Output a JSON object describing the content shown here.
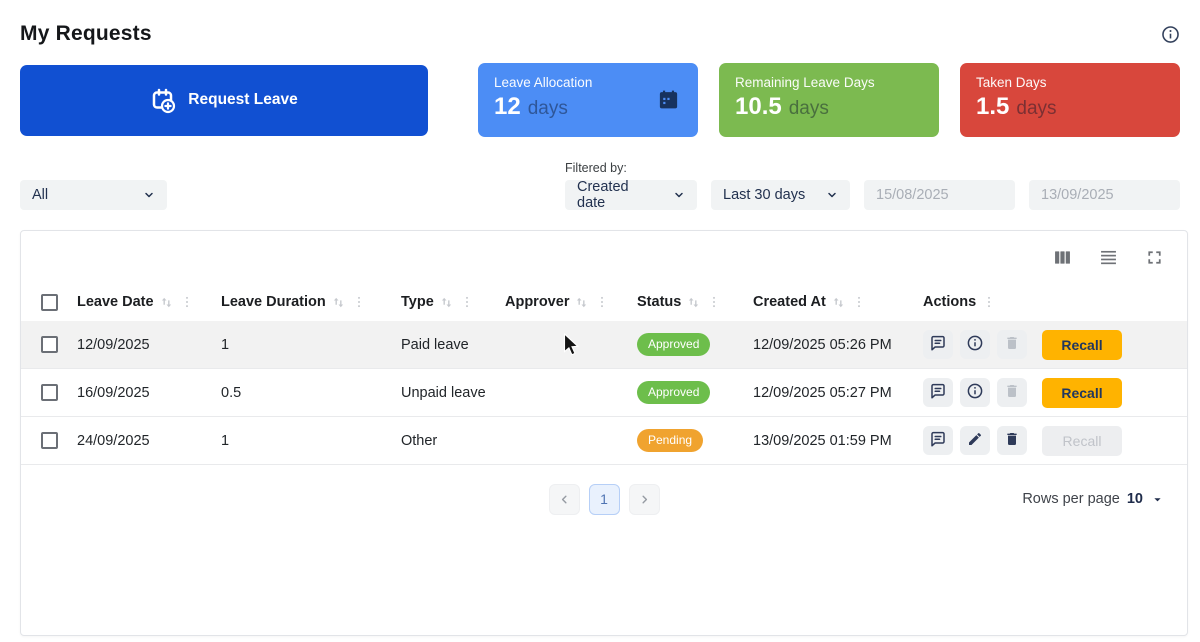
{
  "page_title": "My Requests",
  "colors": {
    "primary_blue": "#1150D2",
    "card_blue": "#4C8DF5",
    "card_green": "#7CBA50",
    "card_red": "#D8473C",
    "recall_amber": "#FFB300",
    "approved_green": "#6DBE4B",
    "pending_amber": "#F0A32F"
  },
  "icons": {
    "page_info": "info-icon",
    "request_leave": "calendar-plus-icon",
    "allocation_card": "calendar-icon",
    "selects": "chevron-down-icon",
    "toolbar": [
      "show-hide-columns-icon",
      "row-density-icon",
      "fullscreen-icon"
    ],
    "header_sort": "sort-arrows-icon",
    "header_menu": "vertical-dots-icon",
    "pagination": [
      "chevron-left-icon",
      "chevron-right-icon",
      "caret-down-icon"
    ]
  },
  "request_button": {
    "label": "Request Leave"
  },
  "stat_cards": [
    {
      "label": "Leave Allocation",
      "value": "12",
      "unit": "days",
      "color": "#4C8DF5",
      "icon": "calendar-icon"
    },
    {
      "label": "Remaining Leave Days",
      "value": "10.5",
      "unit": "days",
      "color": "#7CBA50",
      "icon": ""
    },
    {
      "label": "Taken Days",
      "value": "1.5",
      "unit": "days",
      "color": "#D8473C",
      "icon": ""
    }
  ],
  "filters": {
    "type_select": "All",
    "filtered_by_label": "Filtered by:",
    "field_select": "Created date",
    "range_select": "Last 30 days",
    "date_from": "15/08/2025",
    "date_to": "13/09/2025"
  },
  "table": {
    "select_all_checked": false,
    "columns": [
      {
        "label": "Leave Date",
        "sortable": true
      },
      {
        "label": "Leave Duration",
        "sortable": true
      },
      {
        "label": "Type",
        "sortable": true
      },
      {
        "label": "Approver",
        "sortable": true
      },
      {
        "label": "Status",
        "sortable": true
      },
      {
        "label": "Created At",
        "sortable": true
      },
      {
        "label": "Actions",
        "sortable": false
      }
    ],
    "rows": [
      {
        "checked": false,
        "leave_date": "12/09/2025",
        "leave_duration": "1",
        "type": "Paid leave",
        "approver": "avatar-photo",
        "status": {
          "label": "Approved",
          "color": "#6DBE4B"
        },
        "created_at": "12/09/2025 05:26 PM",
        "action_icons": [
          {
            "icon": "comment-icon",
            "enabled": true
          },
          {
            "icon": "info-icon",
            "enabled": true
          },
          {
            "icon": "trash-icon",
            "enabled": false
          }
        ],
        "recall": {
          "label": "Recall",
          "enabled": true
        },
        "highlighted": true
      },
      {
        "checked": false,
        "leave_date": "16/09/2025",
        "leave_duration": "0.5",
        "type": "Unpaid leave",
        "approver": "avatar-photo",
        "status": {
          "label": "Approved",
          "color": "#6DBE4B"
        },
        "created_at": "12/09/2025 05:27 PM",
        "action_icons": [
          {
            "icon": "comment-icon",
            "enabled": true
          },
          {
            "icon": "info-icon",
            "enabled": true
          },
          {
            "icon": "trash-icon",
            "enabled": false
          }
        ],
        "recall": {
          "label": "Recall",
          "enabled": true
        },
        "highlighted": false
      },
      {
        "checked": false,
        "leave_date": "24/09/2025",
        "leave_duration": "1",
        "type": "Other",
        "approver": "avatar-photo",
        "status": {
          "label": "Pending",
          "color": "#F0A32F"
        },
        "created_at": "13/09/2025 01:59 PM",
        "action_icons": [
          {
            "icon": "comment-icon",
            "enabled": true
          },
          {
            "icon": "edit-icon",
            "enabled": true
          },
          {
            "icon": "trash-icon",
            "enabled": true
          }
        ],
        "recall": {
          "label": "Recall",
          "enabled": false
        },
        "highlighted": false
      }
    ]
  },
  "pagination": {
    "current_page": "1",
    "rows_per_page_label": "Rows per page",
    "rows_per_page_value": "10"
  }
}
